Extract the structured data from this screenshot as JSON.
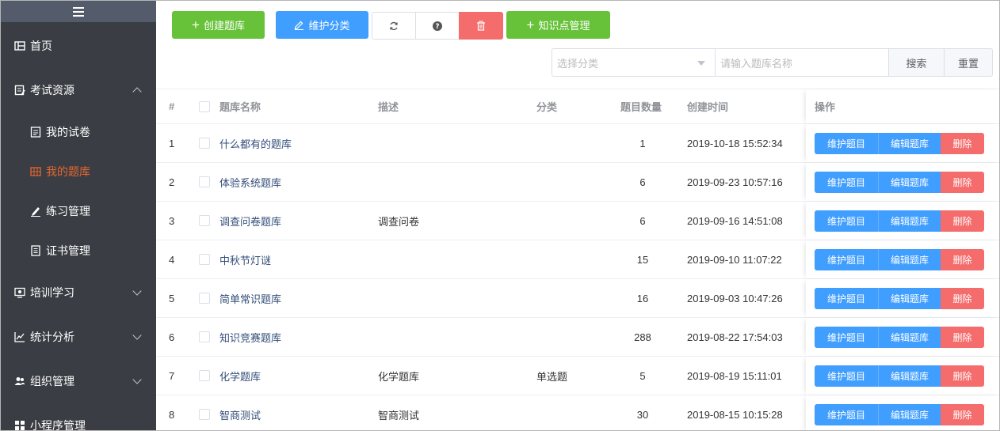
{
  "sidebar": {
    "items": [
      {
        "label": "首页",
        "icon": "home-icon"
      },
      {
        "label": "考试资源",
        "icon": "exam-resource-icon",
        "expanded": true
      },
      {
        "label": "我的试卷",
        "icon": "paper-icon"
      },
      {
        "label": "我的题库",
        "icon": "question-bank-icon",
        "active": true
      },
      {
        "label": "练习管理",
        "icon": "pen-icon"
      },
      {
        "label": "证书管理",
        "icon": "certificate-icon"
      },
      {
        "label": "培训学习",
        "icon": "training-icon"
      },
      {
        "label": "统计分析",
        "icon": "chart-icon"
      },
      {
        "label": "组织管理",
        "icon": "users-icon"
      },
      {
        "label": "小程序管理",
        "icon": "grid-icon"
      }
    ]
  },
  "toolbar": {
    "create_label": "创建题库",
    "category_label": "维护分类",
    "knowledge_label": "知识点管理"
  },
  "filter": {
    "select_placeholder": "选择分类",
    "input_placeholder": "请输入题库名称",
    "search_label": "搜索",
    "reset_label": "重置"
  },
  "table": {
    "headers": {
      "index": "#",
      "name": "题库名称",
      "desc": "描述",
      "category": "分类",
      "count": "题目数量",
      "created": "创建时间",
      "ops": "操作"
    },
    "op_labels": {
      "maintain": "维护题目",
      "edit": "编辑题库",
      "delete": "删除"
    },
    "rows": [
      {
        "index": "1",
        "name": "什么都有的题库",
        "desc": "",
        "category": "",
        "count": "1",
        "created": "2019-10-18 15:52:34"
      },
      {
        "index": "2",
        "name": "体验系统题库",
        "desc": "",
        "category": "",
        "count": "6",
        "created": "2019-09-23 10:57:16"
      },
      {
        "index": "3",
        "name": "调查问卷题库",
        "desc": "调查问卷",
        "category": "",
        "count": "6",
        "created": "2019-09-16 14:51:08"
      },
      {
        "index": "4",
        "name": "中秋节灯谜",
        "desc": "",
        "category": "",
        "count": "15",
        "created": "2019-09-10 11:07:22"
      },
      {
        "index": "5",
        "name": "简单常识题库",
        "desc": "",
        "category": "",
        "count": "16",
        "created": "2019-09-03 10:47:26"
      },
      {
        "index": "6",
        "name": "知识竞赛题库",
        "desc": "",
        "category": "",
        "count": "288",
        "created": "2019-08-22 17:54:03"
      },
      {
        "index": "7",
        "name": "化学题库",
        "desc": "化学题库",
        "category": "单选题",
        "count": "5",
        "created": "2019-08-19 15:11:01"
      },
      {
        "index": "8",
        "name": "智商测试",
        "desc": "智商测试",
        "category": "",
        "count": "30",
        "created": "2019-08-15 10:15:28"
      }
    ]
  },
  "colors": {
    "sidebar_bg": "#3a3d43",
    "active": "#e6662f",
    "green": "#67c23a",
    "blue": "#409eff",
    "red": "#f56c6c"
  }
}
